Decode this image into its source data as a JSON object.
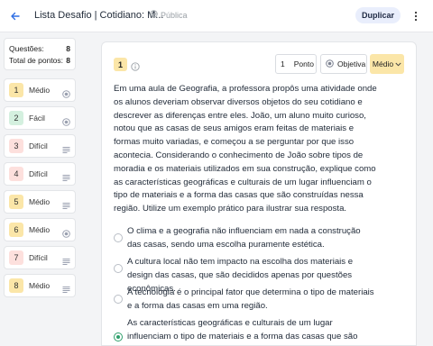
{
  "header": {
    "title": "Lista Desafio | Cotidiano: M...",
    "visibility": "Pública",
    "duplicate_label": "Duplicar"
  },
  "summary": {
    "questions_label": "Questões:",
    "questions_value": "8",
    "points_label": "Total de pontos:",
    "points_value": "8"
  },
  "questions": [
    {
      "number": "1",
      "level": "Médio",
      "type_icon": "radio-icon"
    },
    {
      "number": "2",
      "level": "Fácil",
      "type_icon": "radio-icon"
    },
    {
      "number": "3",
      "level": "Difícil",
      "type_icon": "text-lines-icon"
    },
    {
      "number": "4",
      "level": "Difícil",
      "type_icon": "text-lines-icon"
    },
    {
      "number": "5",
      "level": "Médio",
      "type_icon": "text-lines-icon"
    },
    {
      "number": "6",
      "level": "Médio",
      "type_icon": "radio-icon"
    },
    {
      "number": "7",
      "level": "Difícil",
      "type_icon": "text-lines-icon"
    },
    {
      "number": "8",
      "level": "Médio",
      "type_icon": "text-lines-icon"
    }
  ],
  "level_colors": {
    "Médio": "#fbe6a8",
    "Fácil": "#d4f0df",
    "Difícil": "#fde0dd"
  },
  "editor": {
    "question_number": "1",
    "points_value": "1",
    "points_unit": "Ponto",
    "type_label": "Objetiva",
    "level_label": "Médio",
    "statement": "Em uma aula de Geografia, a professora propôs uma atividade onde os alunos deveriam observar diversos objetos do seu cotidiano e descrever as diferenças entre eles. João, um aluno muito curioso, notou que as casas de seus amigos eram feitas de materiais e formas muito variadas, e começou a se perguntar por que isso acontecia. Considerando o conhecimento de João sobre tipos de moradia e os materiais utilizados em sua construção, explique como as características geográficas e culturais de um lugar influenciam o tipo de materiais e a forma das casas que são construídas nessa região. Utilize um exemplo prático para ilustrar sua resposta.",
    "options": [
      {
        "text": "O clima e a geografia não influenciam em nada a construção das casas, sendo uma escolha puramente estética.",
        "selected": false
      },
      {
        "text": "A cultura local não tem impacto na escolha dos materiais e design das casas, que são decididos apenas por questões econômicas.",
        "selected": false
      },
      {
        "text": "A tecnologia é o principal fator que determina o tipo de materiais e a forma das casas em uma região.",
        "selected": false
      },
      {
        "text": "As características geográficas e culturais de um lugar influenciam o tipo de materiais e a forma das casas que são construídas nessa",
        "selected": true
      }
    ]
  },
  "colors": {
    "accent": "#2f6fe4",
    "correct": "#2e9f6b",
    "badge": "#fbe6a8"
  }
}
